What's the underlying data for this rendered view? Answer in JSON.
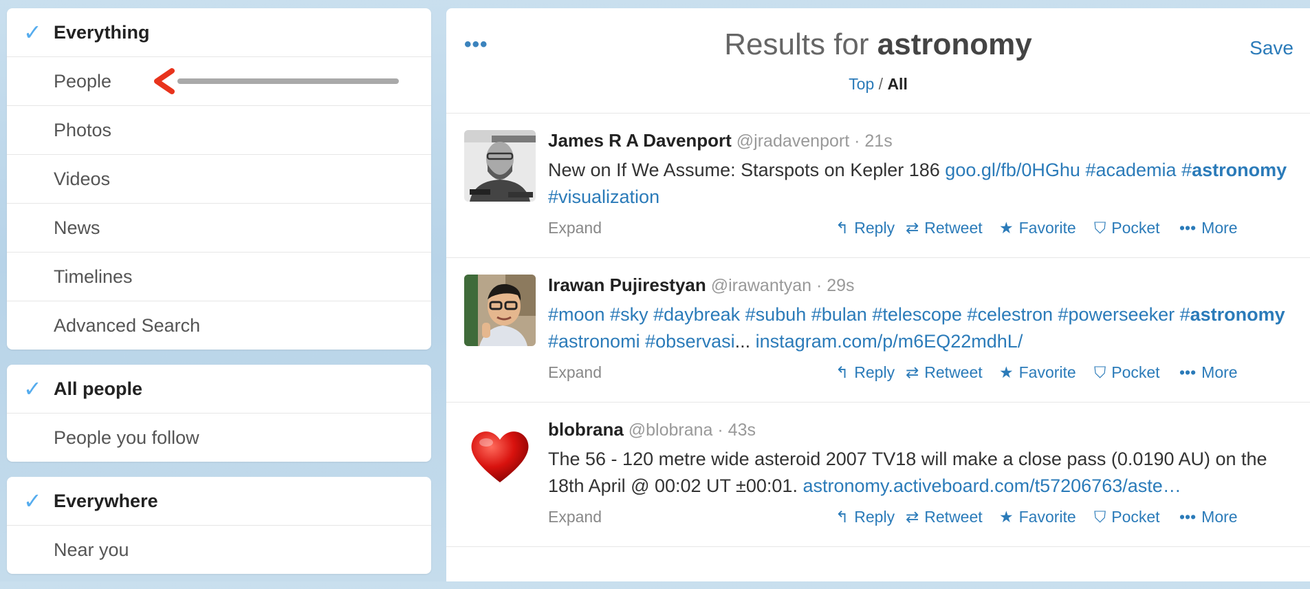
{
  "sidebar": {
    "filters": [
      {
        "label": "Everything",
        "selected": true
      },
      {
        "label": "People",
        "selected": false
      },
      {
        "label": "Photos",
        "selected": false
      },
      {
        "label": "Videos",
        "selected": false
      },
      {
        "label": "News",
        "selected": false
      },
      {
        "label": "Timelines",
        "selected": false
      },
      {
        "label": "Advanced Search",
        "selected": false
      }
    ],
    "people_filter": [
      {
        "label": "All people",
        "selected": true
      },
      {
        "label": "People you follow",
        "selected": false
      }
    ],
    "location_filter": [
      {
        "label": "Everywhere",
        "selected": true
      },
      {
        "label": "Near you",
        "selected": false
      }
    ],
    "check_glyph": "✓"
  },
  "header": {
    "menu_glyph": "•••",
    "title_prefix": "Results for ",
    "query": "astronomy",
    "toggle_top": "Top",
    "toggle_sep": " / ",
    "toggle_all": "All",
    "save_label": "Save"
  },
  "actions": {
    "expand": "Expand",
    "reply": "Reply",
    "retweet": "Retweet",
    "favorite": "Favorite",
    "pocket": "Pocket",
    "more": "More",
    "icons": {
      "reply": "reply-icon",
      "retweet": "retweet-icon",
      "favorite": "star-icon",
      "pocket": "pocket-icon",
      "more": "more-dots-icon"
    }
  },
  "tweets": [
    {
      "fullname": "James R A Davenport",
      "username": "@jradavenport",
      "time": "· 21s",
      "text_parts": [
        {
          "t": "New on If We Assume: Starspots on Kepler 186 ",
          "c": "text"
        },
        {
          "t": "goo.gl/fb/0HGhu",
          "c": "link"
        },
        {
          "t": " ",
          "c": "text"
        },
        {
          "t": "#academia",
          "c": "link"
        },
        {
          "t": " ",
          "c": "text"
        },
        {
          "t": "#",
          "c": "link"
        },
        {
          "t": "astronomy",
          "c": "link-bold"
        },
        {
          "t": " ",
          "c": "text"
        },
        {
          "t": "#visualization",
          "c": "link"
        }
      ]
    },
    {
      "fullname": "Irawan Pujirestyan",
      "username": "@irawantyan",
      "time": "· 29s",
      "text_parts": [
        {
          "t": "#moon #sky #daybreak #subuh #bulan #telescope #celestron #powerseeker ",
          "c": "link"
        },
        {
          "t": "#",
          "c": "link"
        },
        {
          "t": "astronomy",
          "c": "link-bold"
        },
        {
          "t": " #astronomi #observasi",
          "c": "link"
        },
        {
          "t": "... ",
          "c": "text"
        },
        {
          "t": "instagram.com/p/m6EQ22mdhL/",
          "c": "link"
        }
      ]
    },
    {
      "fullname": "blobrana",
      "username": "@blobrana",
      "time": "· 43s",
      "text_parts": [
        {
          "t": "The 56 - 120 metre wide asteroid 2007 TV18 will make a close pass (0.0190 AU) on the 18th April @ 00:02 UT ±00:01. ",
          "c": "text"
        },
        {
          "t": "astronomy.activeboard.com/t57206763/aste…",
          "c": "link"
        }
      ]
    }
  ],
  "colors": {
    "accent": "#2b7bb9",
    "check": "#55acee",
    "annotation_arrow": "#e8331c"
  }
}
